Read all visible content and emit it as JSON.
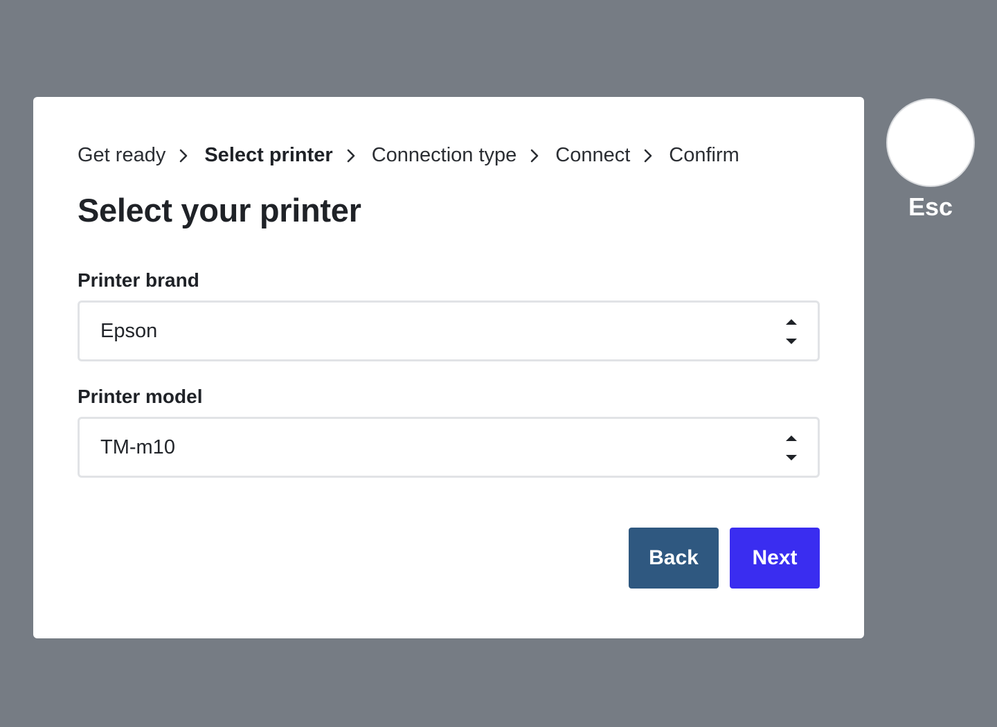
{
  "breadcrumb": {
    "steps": [
      {
        "label": "Get ready"
      },
      {
        "label": "Select printer"
      },
      {
        "label": "Connection type"
      },
      {
        "label": "Connect"
      },
      {
        "label": "Confirm"
      }
    ],
    "active_step": "Select printer"
  },
  "title": "Select your printer",
  "form": {
    "brand": {
      "label": "Printer brand",
      "value": "Epson"
    },
    "model": {
      "label": "Printer model",
      "value": "TM-m10"
    }
  },
  "actions": {
    "back_label": "Back",
    "next_label": "Next"
  },
  "escape": {
    "label": "Esc"
  },
  "colors": {
    "backdrop": "#767c84",
    "back_button": "#2f5880",
    "next_button": "#3a2df0",
    "text": "#1f2227"
  },
  "icons": {
    "separator": "chevron-right-icon",
    "select_arrows": "up-down-arrows-icon"
  }
}
